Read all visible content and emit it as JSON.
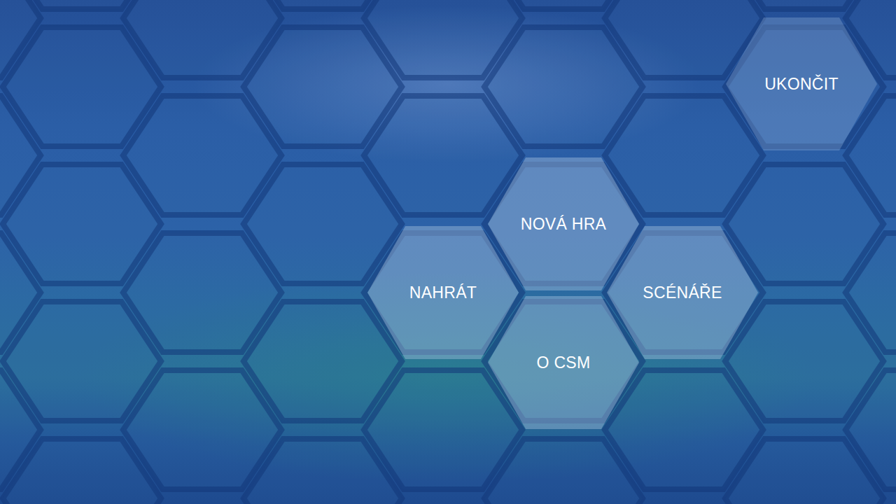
{
  "menu": {
    "items": [
      {
        "label": "NOVÁ HRA"
      },
      {
        "label": "NAHRÁT"
      },
      {
        "label": "SCÉNÁŘE"
      },
      {
        "label": "O CSM"
      }
    ]
  },
  "exit_button": {
    "label": "UKONČIT"
  }
}
